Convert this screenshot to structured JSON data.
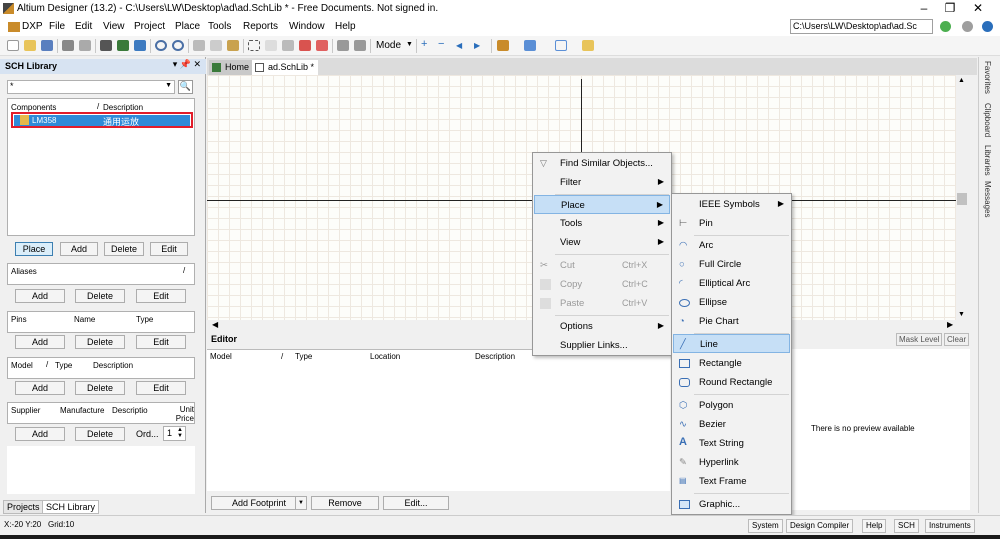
{
  "window": {
    "title": "Altium Designer (13.2) - C:\\Users\\LW\\Desktop\\ad\\ad.SchLib * - Free Documents. Not signed in.",
    "path": "C:\\Users\\LW\\Desktop\\ad\\ad.Sc"
  },
  "menu": [
    "DXP",
    "File",
    "Edit",
    "View",
    "Project",
    "Place",
    "Tools",
    "Reports",
    "Window",
    "Help"
  ],
  "toolbar": {
    "mode_label": "Mode"
  },
  "scl": {
    "title": "SCH Library",
    "filter": "*",
    "col_components": "Components",
    "col_description": "Description",
    "component_name": "LM358",
    "component_desc": "通用运放",
    "btn_place": "Place",
    "btn_add": "Add",
    "btn_delete": "Delete",
    "btn_edit": "Edit"
  },
  "aliases": {
    "title": "Aliases",
    "btn_add": "Add",
    "btn_delete": "Delete",
    "btn_edit": "Edit"
  },
  "pins": {
    "col_pins": "Pins",
    "col_name": "Name",
    "col_type": "Type",
    "btn_add": "Add",
    "btn_delete": "Delete",
    "btn_edit": "Edit"
  },
  "model": {
    "col_model": "Model",
    "col_type": "Type",
    "col_description": "Description",
    "btn_add": "Add",
    "btn_delete": "Delete",
    "btn_edit": "Edit"
  },
  "supplier": {
    "col_supplier": "Supplier",
    "col_manufacturer": "Manufacture",
    "col_description": "Descriptio",
    "col_unit_price": "Unit Price",
    "btn_add": "Add",
    "btn_delete": "Delete",
    "order_label": "Ord...",
    "order_value": "1"
  },
  "bottom_tabs": [
    "Projects",
    "SCH Library"
  ],
  "doc_tabs": [
    "Home",
    "ad.SchLib *"
  ],
  "editor": {
    "title": "Editor",
    "cols": [
      "Model",
      "Type",
      "Location",
      "Description"
    ],
    "btn_add_footprint": "Add Footprint",
    "btn_remove": "Remove",
    "btn_edit": "Edit...",
    "mask_level": "Mask Level",
    "clear": "Clear",
    "no_preview": "There is no preview available"
  },
  "context_menu": {
    "find_similar": "Find Similar Objects...",
    "filter": "Filter",
    "place": "Place",
    "tools": "Tools",
    "view": "View",
    "cut": "Cut",
    "cut_sc": "Ctrl+X",
    "copy": "Copy",
    "copy_sc": "Ctrl+C",
    "paste": "Paste",
    "paste_sc": "Ctrl+V",
    "options": "Options",
    "supplier_links": "Supplier Links..."
  },
  "place_menu": {
    "ieee": "IEEE Symbols",
    "pin": "Pin",
    "arc": "Arc",
    "full_circle": "Full Circle",
    "elliptical_arc": "Elliptical Arc",
    "ellipse": "Ellipse",
    "pie_chart": "Pie Chart",
    "line": "Line",
    "rectangle": "Rectangle",
    "round_rectangle": "Round Rectangle",
    "polygon": "Polygon",
    "bezier": "Bezier",
    "text_string": "Text String",
    "hyperlink": "Hyperlink",
    "text_frame": "Text Frame",
    "graphic": "Graphic..."
  },
  "right_tabs": [
    "Favorites",
    "Clipboard",
    "Libraries",
    "Messages"
  ],
  "status": {
    "coords": "X:-20 Y:20",
    "grid": "Grid:10",
    "buttons": [
      "System",
      "Design Compiler",
      "Help",
      "SCH",
      "Instruments"
    ]
  }
}
